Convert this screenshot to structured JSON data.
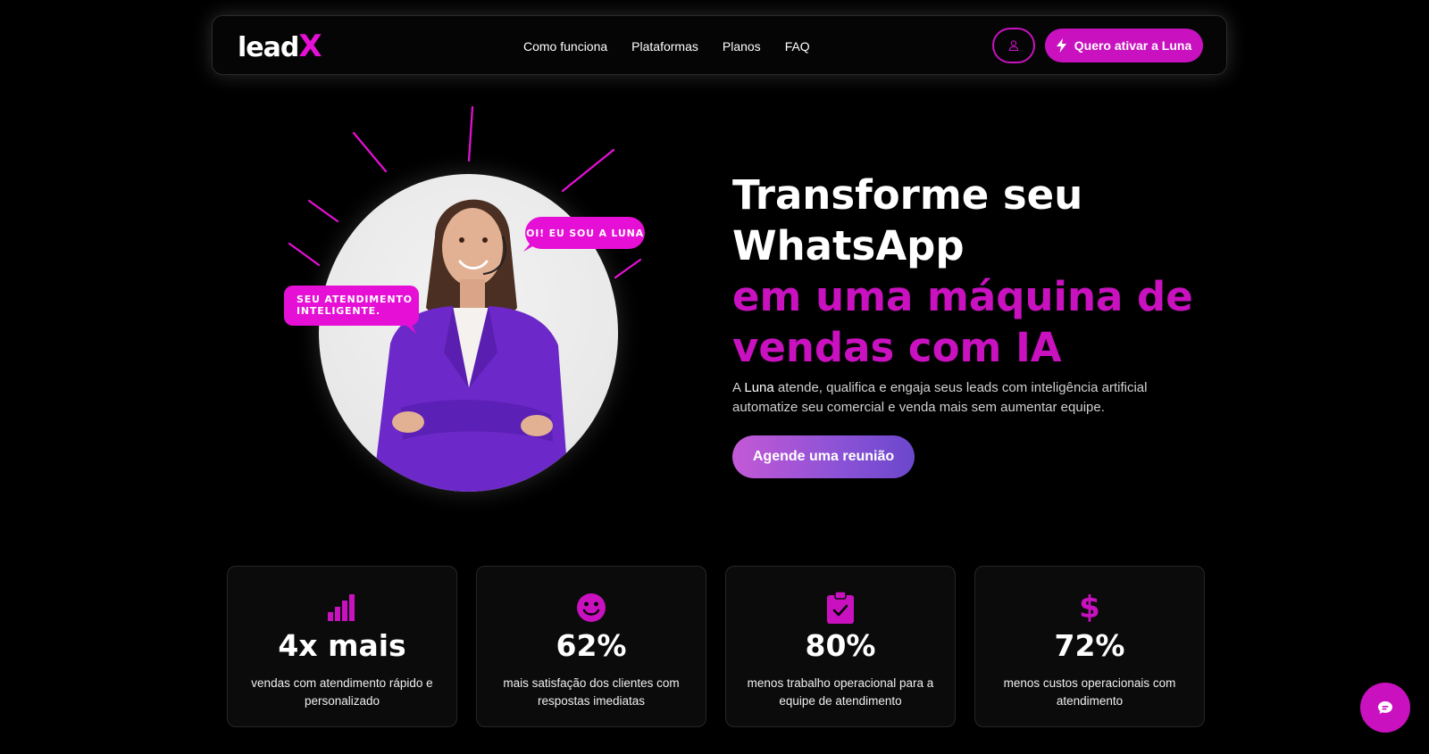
{
  "brand": {
    "logo_main": "lead",
    "logo_accent": "X"
  },
  "nav": {
    "links": [
      "Como funciona",
      "Plataformas",
      "Planos",
      "FAQ"
    ],
    "user_icon": "user-icon",
    "cta_label": "Quero ativar a Luna",
    "cta_icon": "lightning-icon"
  },
  "hero": {
    "bubble_right": "OI! EU SOU A LUNA",
    "bubble_left_line1": "SEU ATENDIMENTO",
    "bubble_left_line2": "INTELIGENTE.",
    "title_line1": "Transforme seu",
    "title_line2": "WhatsApp",
    "title_line3": "em uma máquina de",
    "title_line4": "vendas com IA",
    "subtitle_prefix": "A ",
    "subtitle_highlight": "Luna",
    "subtitle_rest_line1": " atende, qualifica e engaja seus leads com inteligência artificial",
    "subtitle_line2": "automatize seu comercial e venda mais sem aumentar equipe.",
    "cta_label": "Agende uma reunião"
  },
  "stats": [
    {
      "icon": "bar-chart-icon",
      "value": "4x mais",
      "description": "vendas com atendimento rápido e personalizado"
    },
    {
      "icon": "smile-icon",
      "value": "62%",
      "description": "mais satisfação dos clientes com respostas imediatas"
    },
    {
      "icon": "clipboard-check-icon",
      "value": "80%",
      "description": "menos trabalho operacional para a equipe de atendimento"
    },
    {
      "icon": "dollar-icon",
      "value": "72%",
      "description": "menos custos operacionais com atendimento"
    }
  ],
  "colors": {
    "accent": "#c911c0",
    "accent_bright": "#e60fd6",
    "background": "#000000"
  },
  "chat_icon": "chat-bubble-icon"
}
